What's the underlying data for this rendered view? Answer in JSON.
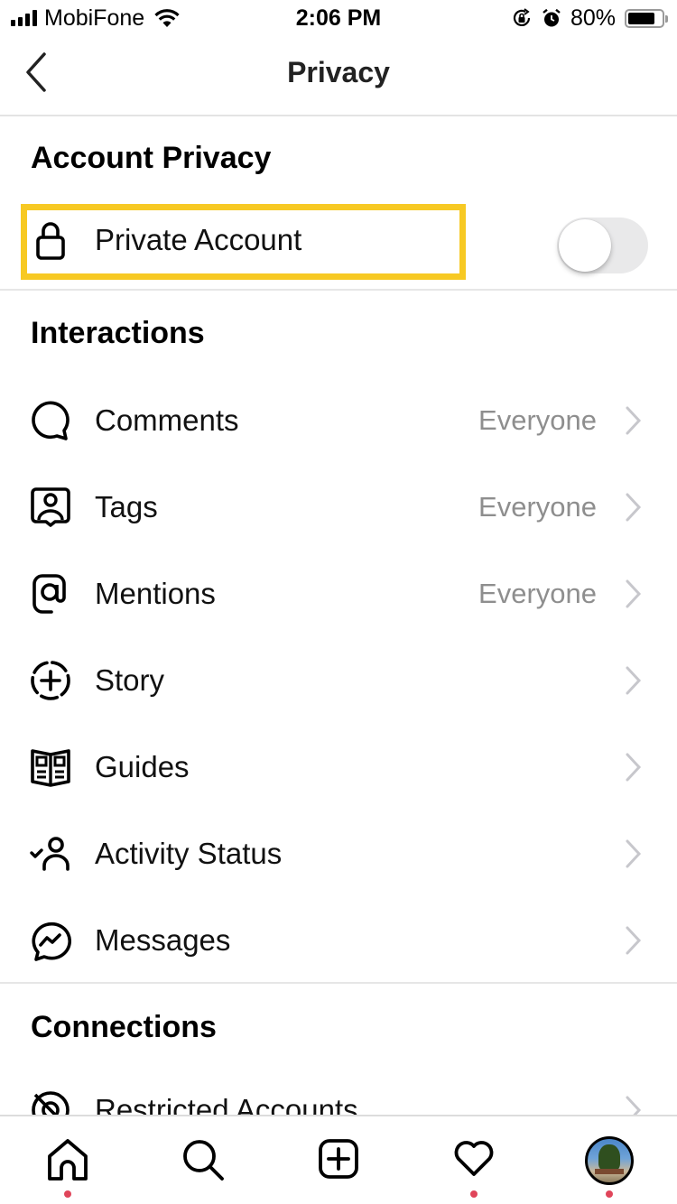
{
  "status_bar": {
    "carrier": "MobiFone",
    "time": "2:06 PM",
    "battery_percent": "80%",
    "battery_level": 0.8,
    "icons": [
      "signal-icon",
      "wifi-icon",
      "orientation-lock-icon",
      "alarm-icon",
      "battery-icon"
    ]
  },
  "nav": {
    "title": "Privacy",
    "back_icon": "chevron-left-icon"
  },
  "sections": {
    "account_privacy": {
      "title": "Account Privacy",
      "items": [
        {
          "label": "Private Account",
          "icon": "lock-icon",
          "toggle_on": false
        }
      ]
    },
    "interactions": {
      "title": "Interactions",
      "items": [
        {
          "label": "Comments",
          "value": "Everyone",
          "icon": "comment-icon"
        },
        {
          "label": "Tags",
          "value": "Everyone",
          "icon": "tag-person-icon"
        },
        {
          "label": "Mentions",
          "value": "Everyone",
          "icon": "at-sign-icon"
        },
        {
          "label": "Story",
          "value": "",
          "icon": "story-add-icon"
        },
        {
          "label": "Guides",
          "value": "",
          "icon": "guides-book-icon"
        },
        {
          "label": "Activity Status",
          "value": "",
          "icon": "activity-status-icon"
        },
        {
          "label": "Messages",
          "value": "",
          "icon": "messenger-icon"
        }
      ]
    },
    "connections": {
      "title": "Connections",
      "items": [
        {
          "label": "Restricted Accounts",
          "icon": "restricted-icon"
        }
      ]
    }
  },
  "highlight_color": "#f7c923",
  "tab_bar": {
    "tabs": [
      {
        "name": "home",
        "icon": "home-icon",
        "has_dot": true
      },
      {
        "name": "search",
        "icon": "search-icon",
        "has_dot": false
      },
      {
        "name": "new-post",
        "icon": "plus-square-icon",
        "has_dot": false
      },
      {
        "name": "activity",
        "icon": "heart-icon",
        "has_dot": true
      },
      {
        "name": "profile",
        "icon": "avatar",
        "has_dot": true
      }
    ],
    "dot_color": "#e0455a"
  }
}
